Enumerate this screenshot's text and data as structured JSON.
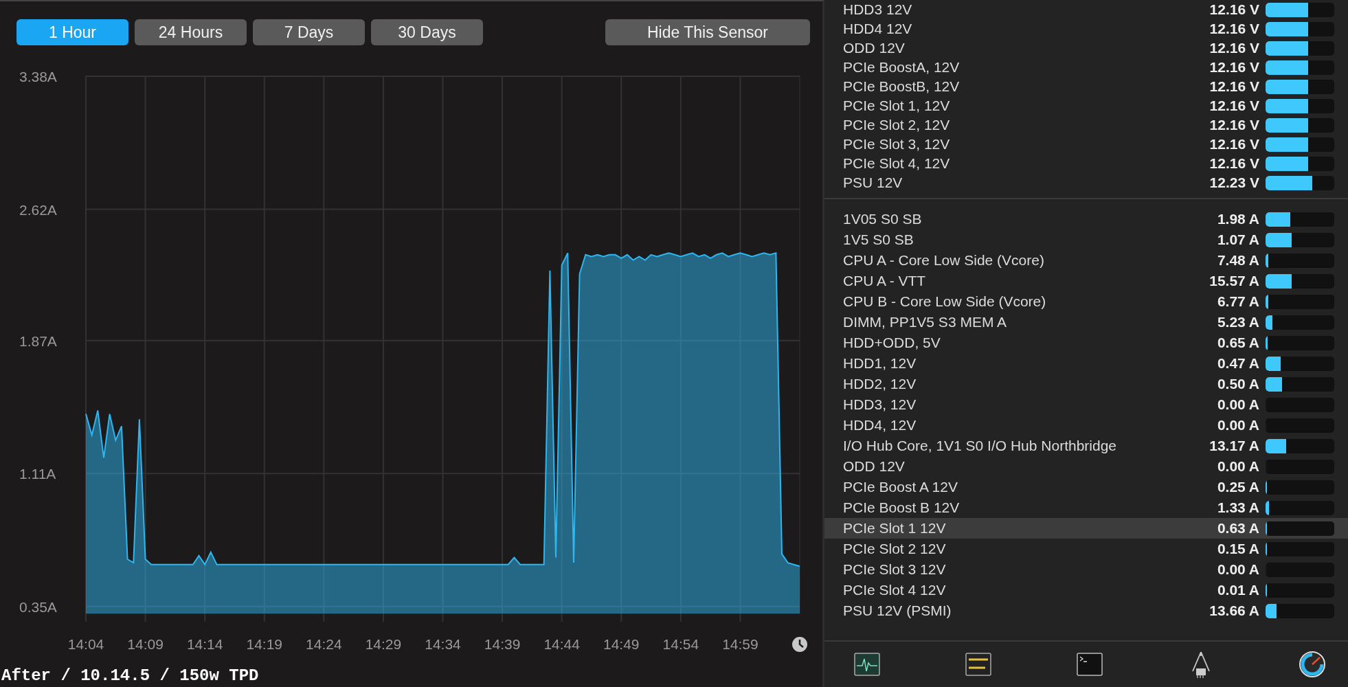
{
  "tabs": [
    {
      "label": "1 Hour",
      "selected": true
    },
    {
      "label": "24 Hours",
      "selected": false
    },
    {
      "label": "7 Days",
      "selected": false
    },
    {
      "label": "30 Days",
      "selected": false
    }
  ],
  "hide_button": "Hide This Sensor",
  "chart_data": {
    "type": "area",
    "categories": [
      "14:04",
      null,
      null,
      null,
      null,
      null,
      null,
      null,
      null,
      null,
      "14:09",
      null,
      null,
      null,
      null,
      null,
      null,
      null,
      null,
      null,
      "14:14",
      null,
      null,
      null,
      null,
      null,
      null,
      null,
      null,
      null,
      "14:19",
      null,
      null,
      null,
      null,
      null,
      null,
      null,
      null,
      null,
      "14:24",
      null,
      null,
      null,
      null,
      null,
      null,
      null,
      null,
      null,
      "14:29",
      null,
      null,
      null,
      null,
      null,
      null,
      null,
      null,
      null,
      "14:34",
      null,
      null,
      null,
      null,
      null,
      null,
      null,
      null,
      null,
      "14:39",
      null,
      null,
      null,
      null,
      null,
      null,
      null,
      null,
      null,
      "14:44",
      null,
      null,
      null,
      null,
      null,
      null,
      null,
      null,
      null,
      "14:49",
      null,
      null,
      null,
      null,
      null,
      null,
      null,
      null,
      null,
      "14:54",
      null,
      null,
      null,
      null,
      null,
      null,
      null,
      null,
      null,
      "14:59",
      null,
      null,
      null,
      null,
      null,
      null,
      null,
      null,
      null,
      null
    ],
    "series": [
      {
        "color": "#2eb6f0",
        "values": [
          1.45,
          1.33,
          1.47,
          1.2,
          1.45,
          1.3,
          1.38,
          0.62,
          0.6,
          1.42,
          0.62,
          0.59,
          0.59,
          0.59,
          0.59,
          0.59,
          0.59,
          0.59,
          0.59,
          0.64,
          0.59,
          0.66,
          0.59,
          0.59,
          0.59,
          0.59,
          0.59,
          0.59,
          0.59,
          0.59,
          0.59,
          0.59,
          0.59,
          0.59,
          0.59,
          0.59,
          0.59,
          0.59,
          0.59,
          0.59,
          0.59,
          0.59,
          0.59,
          0.59,
          0.59,
          0.59,
          0.59,
          0.59,
          0.59,
          0.59,
          0.59,
          0.59,
          0.59,
          0.59,
          0.59,
          0.59,
          0.59,
          0.59,
          0.59,
          0.59,
          0.59,
          0.59,
          0.59,
          0.59,
          0.59,
          0.59,
          0.59,
          0.59,
          0.59,
          0.59,
          0.59,
          0.59,
          0.63,
          0.59,
          0.59,
          0.59,
          0.59,
          0.59,
          2.27,
          0.63,
          2.3,
          2.37,
          0.6,
          2.25,
          2.36,
          2.35,
          2.36,
          2.35,
          2.36,
          2.36,
          2.34,
          2.36,
          2.33,
          2.35,
          2.33,
          2.36,
          2.35,
          2.36,
          2.37,
          2.36,
          2.35,
          2.36,
          2.37,
          2.35,
          2.36,
          2.34,
          2.36,
          2.37,
          2.35,
          2.36,
          2.37,
          2.36,
          2.35,
          2.36,
          2.37,
          2.36,
          2.37,
          0.65,
          0.6,
          0.59,
          0.58
        ]
      }
    ],
    "ylim": [
      0.31,
      3.38
    ],
    "grid": true,
    "yticks": [
      {
        "value": 3.38,
        "label": "3.38A"
      },
      {
        "value": 2.62,
        "label": "2.62A"
      },
      {
        "value": 1.87,
        "label": "1.87A"
      },
      {
        "value": 1.11,
        "label": "1.11A"
      },
      {
        "value": 0.35,
        "label": "0.35A"
      }
    ]
  },
  "caption": "After / 10.14.5 / 150w TPD",
  "sensor_groups": [
    {
      "rows": [
        {
          "name": "HDD3 12V",
          "reading": "12.16 V",
          "level": 0.62,
          "selected": false
        },
        {
          "name": "HDD4 12V",
          "reading": "12.16 V",
          "level": 0.62,
          "selected": false
        },
        {
          "name": "ODD 12V",
          "reading": "12.16 V",
          "level": 0.62,
          "selected": false
        },
        {
          "name": "PCIe BoostA, 12V",
          "reading": "12.16 V",
          "level": 0.62,
          "selected": false
        },
        {
          "name": "PCIe BoostB, 12V",
          "reading": "12.16 V",
          "level": 0.62,
          "selected": false
        },
        {
          "name": "PCIe Slot 1, 12V",
          "reading": "12.16 V",
          "level": 0.62,
          "selected": false
        },
        {
          "name": "PCIe Slot 2, 12V",
          "reading": "12.16 V",
          "level": 0.62,
          "selected": false
        },
        {
          "name": "PCIe Slot 3, 12V",
          "reading": "12.16 V",
          "level": 0.62,
          "selected": false
        },
        {
          "name": "PCIe Slot 4, 12V",
          "reading": "12.16 V",
          "level": 0.62,
          "selected": false
        },
        {
          "name": "PSU 12V",
          "reading": "12.23 V",
          "level": 0.68,
          "selected": false
        }
      ]
    },
    {
      "rows": [
        {
          "name": "1V05 S0 SB",
          "reading": "1.98 A",
          "level": 0.36,
          "selected": false
        },
        {
          "name": "1V5 S0 SB",
          "reading": "1.07 A",
          "level": 0.38,
          "selected": false
        },
        {
          "name": "CPU A - Core Low Side (Vcore)",
          "reading": "7.48 A",
          "level": 0.04,
          "selected": false
        },
        {
          "name": "CPU A - VTT",
          "reading": "15.57 A",
          "level": 0.38,
          "selected": false
        },
        {
          "name": "CPU B - Core Low Side (Vcore)",
          "reading": "6.77 A",
          "level": 0.04,
          "selected": false
        },
        {
          "name": "DIMM, PP1V5 S3 MEM A",
          "reading": "5.23 A",
          "level": 0.1,
          "selected": false
        },
        {
          "name": "HDD+ODD, 5V",
          "reading": "0.65 A",
          "level": 0.03,
          "selected": false
        },
        {
          "name": "HDD1, 12V",
          "reading": "0.47 A",
          "level": 0.22,
          "selected": false
        },
        {
          "name": "HDD2, 12V",
          "reading": "0.50 A",
          "level": 0.24,
          "selected": false
        },
        {
          "name": "HDD3, 12V",
          "reading": "0.00 A",
          "level": 0,
          "selected": false
        },
        {
          "name": "HDD4, 12V",
          "reading": "0.00 A",
          "level": 0,
          "selected": false
        },
        {
          "name": "I/O Hub Core, 1V1 S0 I/O Hub Northbridge",
          "reading": "13.17 A",
          "level": 0.3,
          "selected": false
        },
        {
          "name": "ODD 12V",
          "reading": "0.00 A",
          "level": 0,
          "selected": false
        },
        {
          "name": "PCIe Boost A 12V",
          "reading": "0.25 A",
          "level": 0.02,
          "selected": false
        },
        {
          "name": "PCIe Boost B 12V",
          "reading": "1.33 A",
          "level": 0.05,
          "selected": false
        },
        {
          "name": "PCIe Slot 1 12V",
          "reading": "0.63 A",
          "level": 0.02,
          "selected": true
        },
        {
          "name": "PCIe Slot 2 12V",
          "reading": "0.15 A",
          "level": 0.02,
          "selected": false
        },
        {
          "name": "PCIe Slot 3 12V",
          "reading": "0.00 A",
          "level": 0,
          "selected": false
        },
        {
          "name": "PCIe Slot 4 12V",
          "reading": "0.01 A",
          "level": 0.02,
          "selected": false
        },
        {
          "name": "PSU 12V (PSMI)",
          "reading": "13.66 A",
          "level": 0.16,
          "selected": false
        }
      ]
    }
  ]
}
